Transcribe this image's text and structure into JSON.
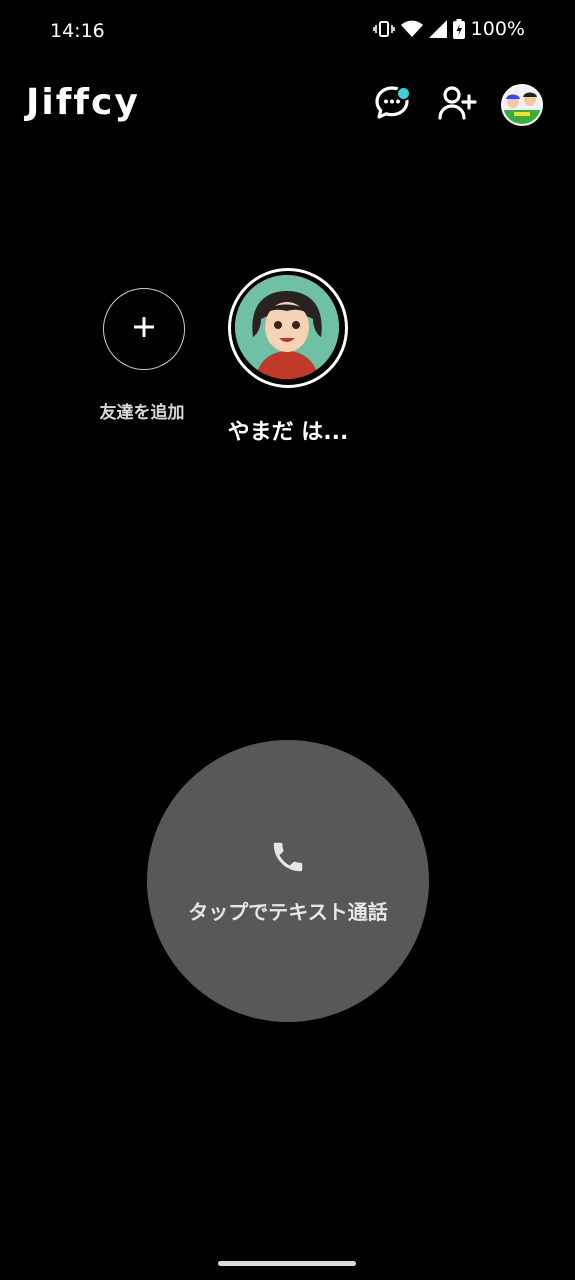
{
  "status_bar": {
    "time": "14:16",
    "battery": "100%"
  },
  "header": {
    "app_name": "Jiffcy",
    "icons": [
      "chat-icon",
      "add-friend-icon",
      "profile-avatar"
    ]
  },
  "friends": {
    "add": {
      "label": "友達を追加",
      "icon": "plus-icon"
    },
    "items": [
      {
        "name": "やまだ は..."
      }
    ]
  },
  "call": {
    "label": "タップでテキスト通話",
    "icon": "phone-icon"
  },
  "colors": {
    "background": "#000000",
    "call_button": "#585858",
    "accent_dot": "#3fd0d6"
  }
}
